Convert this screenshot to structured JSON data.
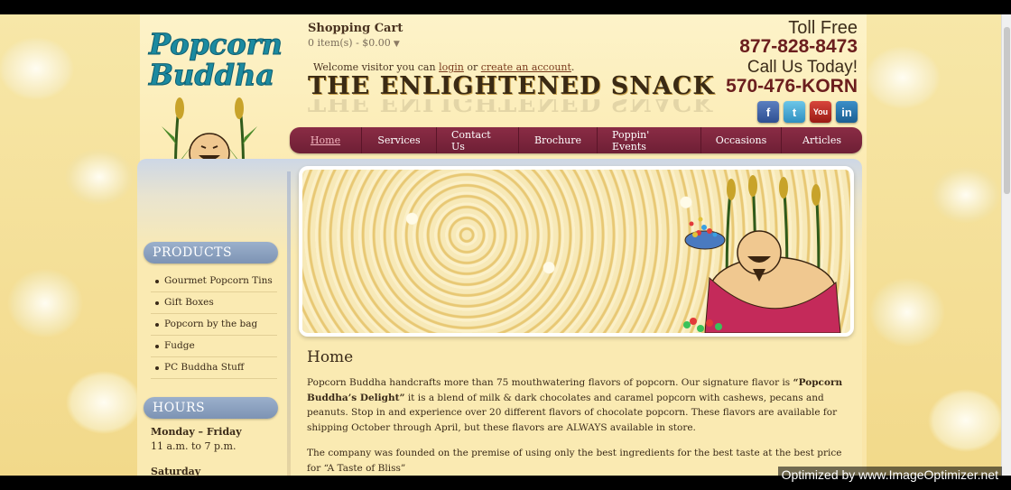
{
  "header": {
    "cart_title": "Shopping Cart",
    "cart_items": "0 item(s) - $0.00",
    "welcome_prefix": "Welcome visitor you can",
    "login_label": "login",
    "or_text": "or",
    "create_account_label": "create an account",
    "welcome_suffix": ".",
    "tagline": "THE ENLIGHTENED SNACK",
    "logo_line1": "Popcorn",
    "logo_line2": "Buddha"
  },
  "contact": {
    "toll_free": "Toll Free",
    "phone1": "877-828-8473",
    "call_us": "Call Us Today!",
    "phone2": "570-476-KORN"
  },
  "social": {
    "facebook": "f",
    "twitter": "t",
    "youtube": "You",
    "linkedin": "in"
  },
  "nav": {
    "items": [
      "Home",
      "Services",
      "Contact Us",
      "Brochure",
      "Poppin' Events",
      "Occasions",
      "Articles"
    ]
  },
  "sidebar": {
    "products_heading": "PRODUCTS",
    "products": [
      "Gourmet Popcorn Tins",
      "Gift Boxes",
      "Popcorn by the bag",
      "Fudge",
      "PC Buddha Stuff"
    ],
    "hours_heading": "HOURS",
    "hours_day1": "Monday – Friday",
    "hours_time1": "11 a.m. to 7 p.m.",
    "hours_day2": "Saturday"
  },
  "main": {
    "title": "Home",
    "p1_a": "Popcorn Buddha handcrafts more than 75 mouthwatering flavors of popcorn. Our signature flavor is ",
    "p1_bold": "“Popcorn Buddha’s Delight”",
    "p1_b": " it is a blend of milk & dark chocolates and caramel popcorn with cashews, pecans and peanuts. Stop in and experience over 20 different flavors of chocolate popcorn. These flavors are available for shipping October through April, but these flavors are ALWAYS available in store.",
    "p2": "The company was founded on the premise of using only the best ingredients for the best taste at the best price for “A Taste of Bliss”"
  },
  "watermark": "Optimized by www.ImageOptimizer.net"
}
